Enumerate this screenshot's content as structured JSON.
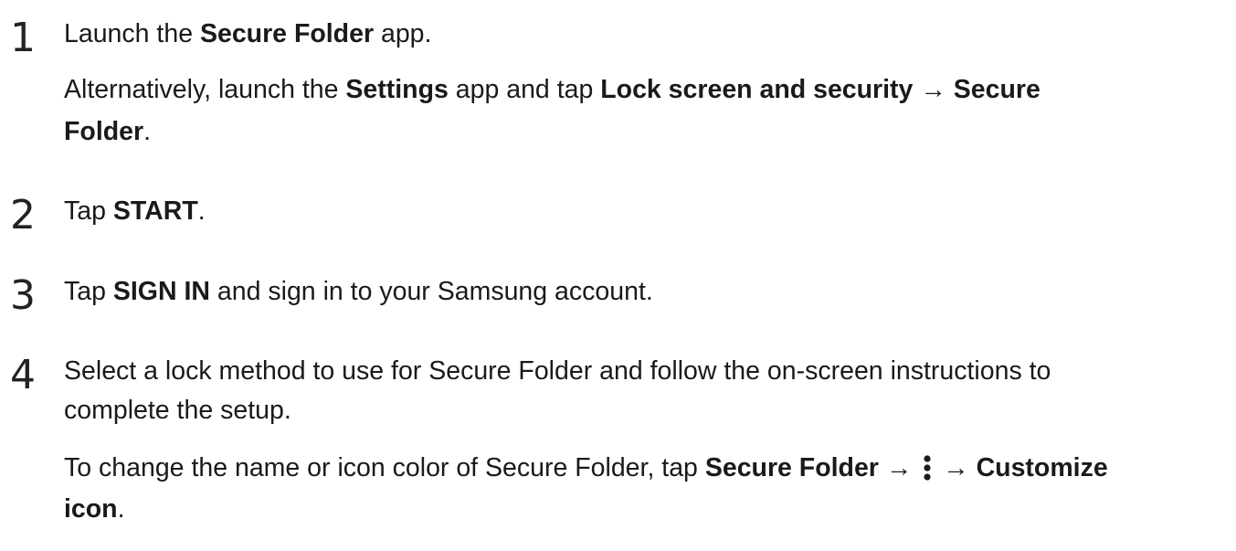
{
  "steps": [
    {
      "number": "1",
      "line1": {
        "t1": "Launch the ",
        "b1": "Secure Folder",
        "t2": " app."
      },
      "note1": {
        "t1": "Alternatively, launch the ",
        "b1": "Settings",
        "t2": " app and tap ",
        "b2": "Lock screen and security",
        "arrow": " → ",
        "b3": "Secure"
      },
      "note2": {
        "b1": "Folder",
        "t1": "."
      }
    },
    {
      "number": "2",
      "line1": {
        "t1": "Tap ",
        "b1": "START",
        "t2": "."
      }
    },
    {
      "number": "3",
      "line1": {
        "t1": "Tap ",
        "b1": "SIGN IN",
        "t2": " and sign in to your Samsung account."
      }
    },
    {
      "number": "4",
      "line1": {
        "t1": "Select a lock method to use for Secure Folder and follow the on-screen instructions to"
      },
      "line2": {
        "t1": "complete the setup."
      },
      "note1": {
        "t1": "To change the name or icon color of Secure Folder, tap ",
        "b1": "Secure Folder",
        "arrow1": " → ",
        "icon": "more-options-icon",
        "arrow2": " → ",
        "b2": "Customize"
      },
      "note2": {
        "b1": "icon",
        "t1": "."
      }
    }
  ]
}
